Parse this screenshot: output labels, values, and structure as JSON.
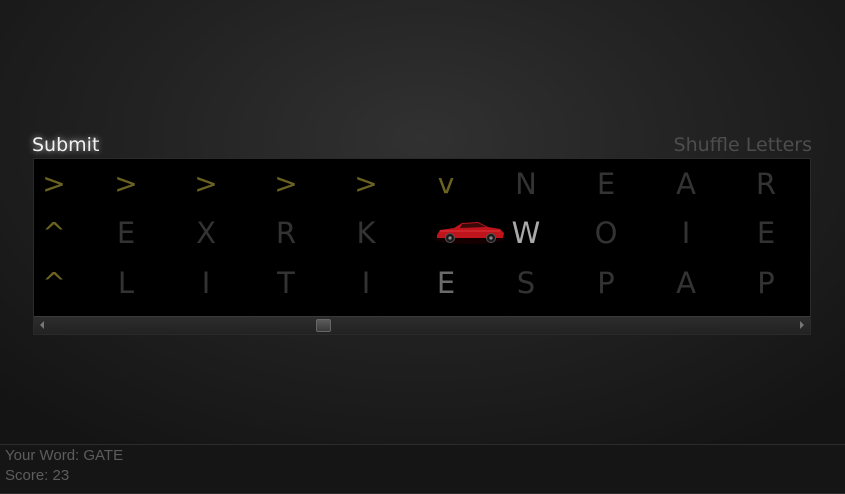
{
  "buttons": {
    "submit_label": "Submit",
    "shuffle_label": "Shuffle Letters"
  },
  "grid": {
    "rows": [
      [
        {
          "char": ">",
          "style": "arrow"
        },
        {
          "char": ">",
          "style": "arrow"
        },
        {
          "char": ">",
          "style": "arrow"
        },
        {
          "char": ">",
          "style": "arrow"
        },
        {
          "char": ">",
          "style": "arrow"
        },
        {
          "char": "v",
          "style": "arrow"
        },
        {
          "char": "N",
          "style": "dim"
        },
        {
          "char": "E",
          "style": "dim"
        },
        {
          "char": "A",
          "style": "dim"
        },
        {
          "char": "R",
          "style": "dim"
        }
      ],
      [
        {
          "char": "^",
          "style": "arrow"
        },
        {
          "char": "E",
          "style": "dim"
        },
        {
          "char": "X",
          "style": "dim"
        },
        {
          "char": "R",
          "style": "dim"
        },
        {
          "char": "K",
          "style": "dim"
        },
        {
          "char": "",
          "style": "car"
        },
        {
          "char": "W",
          "style": "bright"
        },
        {
          "char": "O",
          "style": "dim"
        },
        {
          "char": "I",
          "style": "dim"
        },
        {
          "char": "E",
          "style": "dim"
        }
      ],
      [
        {
          "char": "^",
          "style": "arrow"
        },
        {
          "char": "L",
          "style": "dim"
        },
        {
          "char": "I",
          "style": "dim"
        },
        {
          "char": "T",
          "style": "dim"
        },
        {
          "char": "I",
          "style": "dim"
        },
        {
          "char": "E",
          "style": "mid"
        },
        {
          "char": "S",
          "style": "dim"
        },
        {
          "char": "P",
          "style": "dim"
        },
        {
          "char": "A",
          "style": "dim"
        },
        {
          "char": "P",
          "style": "dim"
        }
      ]
    ]
  },
  "status": {
    "word_line": "Your Word: GATE",
    "score_line": "Score: 23"
  },
  "icons": {
    "car": "red-race-car-icon"
  },
  "colors": {
    "arrow": "#6b6320",
    "dim_letter": "#333333",
    "bright_letter": "#a9a9a9",
    "car_body": "#c0141c"
  }
}
